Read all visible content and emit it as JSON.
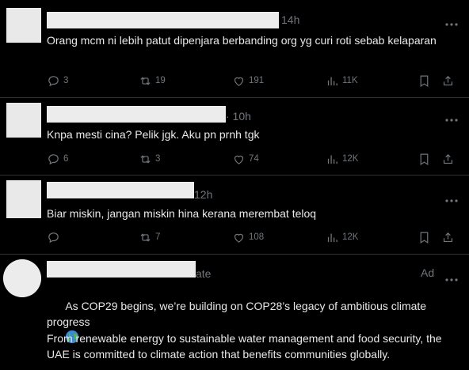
{
  "posts": [
    {
      "time": "14h",
      "text": "Orang mcm ni lebih patut dipenjara berbanding org yg curi roti sebab kelaparan",
      "replies": "3",
      "reposts": "19",
      "likes": "191",
      "views": "11K"
    },
    {
      "time": "· 10h",
      "text": "Knpa mesti cina? Pelik jgk. Aku pn prnh tgk",
      "replies": "6",
      "reposts": "3",
      "likes": "74",
      "views": "12K"
    },
    {
      "time": "12h",
      "text": "Biar miskin, jangan miskin hina kerana merembat teloq",
      "replies": "",
      "reposts": "7",
      "likes": "108",
      "views": "12K"
    }
  ],
  "ad": {
    "handle_suffix": "ate",
    "label": "Ad",
    "text_line1": "As COP29 begins, we’re building on COP28’s legacy of ambitious climate progress",
    "text_para2": "From renewable energy to sustainable water management and food security, the UAE is committed to climate action that benefits communities globally.",
    "emoji": "globe-americas-emoji"
  },
  "colors": {
    "background": "#000000",
    "text": "#e7e9ea",
    "muted": "#71767b",
    "divider": "#2f3336"
  },
  "icons": [
    "reply-icon",
    "repost-icon",
    "like-icon",
    "views-icon",
    "bookmark-icon",
    "share-icon",
    "more-icon"
  ]
}
